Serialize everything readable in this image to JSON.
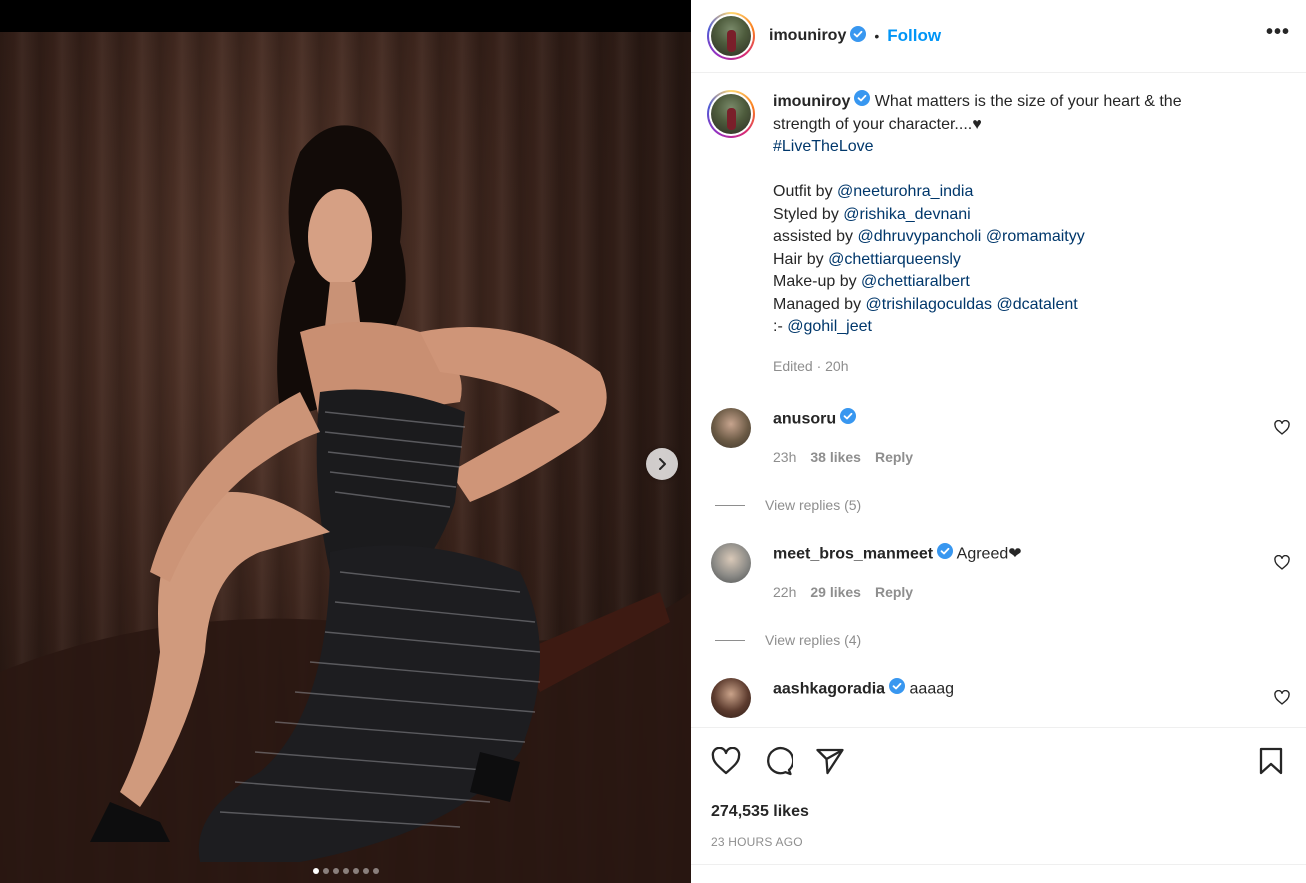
{
  "post": {
    "username": "imouniroy",
    "follow_label": "Follow",
    "separator": "•",
    "more_label": "•••"
  },
  "caption": {
    "username": "imouniroy",
    "first": "What matters is the size of your heart & the strength of your character....♥",
    "hashtag": "#LiveTheLove",
    "credits": [
      {
        "prefix": "Outfit by ",
        "mentions": [
          "@neeturohra_india"
        ]
      },
      {
        "prefix": "Styled by ",
        "mentions": [
          "@rishika_devnani"
        ]
      },
      {
        "prefix": "assisted by ",
        "mentions": [
          "@dhruvypancholi",
          "@romamaityy"
        ]
      },
      {
        "prefix": "Hair by ",
        "mentions": [
          "@chettiarqueensly"
        ]
      },
      {
        "prefix": "Make-up by ",
        "mentions": [
          "@chettiaralbert"
        ]
      },
      {
        "prefix": "Managed by ",
        "mentions": [
          "@trishilagoculdas",
          "@dcatalent"
        ]
      },
      {
        "prefix": ":- ",
        "mentions": [
          "@gohil_jeet"
        ]
      }
    ],
    "meta": "Edited · 20h"
  },
  "comments": [
    {
      "username": "anusoru",
      "verified": true,
      "text": "",
      "time": "23h",
      "likes": "38 likes",
      "reply": "Reply",
      "view_replies": "View replies (5)"
    },
    {
      "username": "meet_bros_manmeet",
      "verified": true,
      "text": "Agreed❤",
      "time": "22h",
      "likes": "29 likes",
      "reply": "Reply",
      "view_replies": "View replies (4)"
    },
    {
      "username": "aashkagoradia",
      "verified": true,
      "text": "aaaag",
      "time": "",
      "likes": "",
      "reply": "",
      "view_replies": ""
    }
  ],
  "stats": {
    "likes": "274,535 likes",
    "time": "23 HOURS AGO"
  },
  "carousel": {
    "count": 7,
    "active_index": 0
  },
  "icons": [
    "like-icon",
    "comment-icon",
    "share-icon",
    "save-icon",
    "next-arrow-icon",
    "verified-icon",
    "more-options-icon",
    "comment-like-icon"
  ],
  "colors": {
    "follow": "#0095f6",
    "mention": "#00376b",
    "secondary_text": "#8e8e8e"
  }
}
